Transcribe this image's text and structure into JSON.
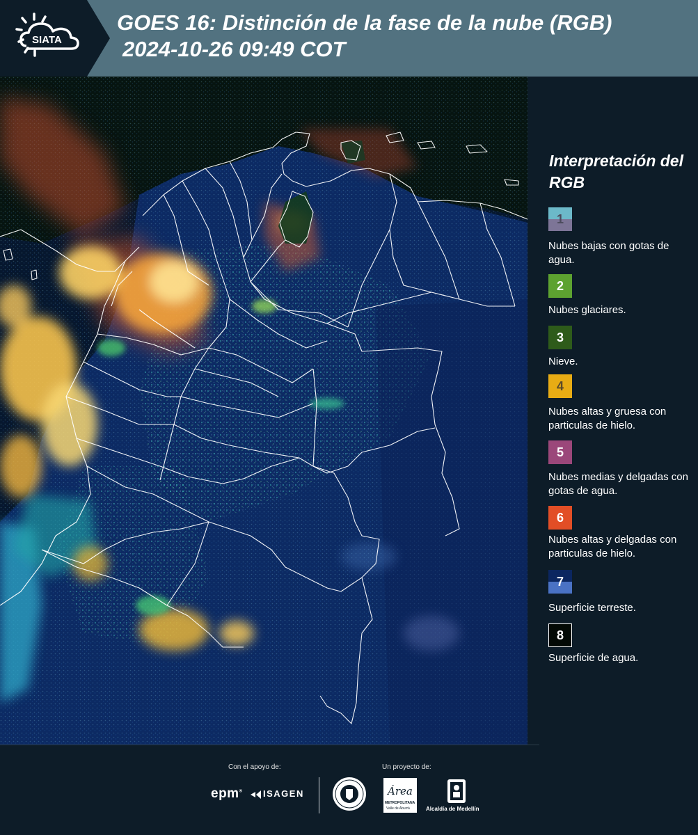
{
  "header": {
    "logo_text": "SIATA",
    "title_line1": "GOES 16: Distinción de la fase de la nube (RGB)",
    "title_line2": "2024-10-26 09:49 COT"
  },
  "legend": {
    "title": "Interpretación del RGB",
    "items": [
      {
        "number": "1",
        "label": "Nubes bajas con gotas de agua.",
        "color_top": "#6cb9c9",
        "color_bottom": "#7d7597",
        "number_color": "#4b4b5c"
      },
      {
        "number": "2",
        "label": "Nubes glaciares.",
        "color_top": "#5da230",
        "color_bottom": "#5da230",
        "number_color": "#ffffff"
      },
      {
        "number": "3",
        "label": "Nieve.",
        "color_top": "#2e5b1a",
        "color_bottom": "#2e5b1a",
        "number_color": "#ffffff"
      },
      {
        "number": "4",
        "label": "Nubes altas y gruesa con particulas de hielo.",
        "color_top": "#e8ac14",
        "color_bottom": "#e8ac14",
        "number_color": "#5a4a2a"
      },
      {
        "number": "5",
        "label": "Nubes medias y delgadas con gotas de agua.",
        "color_top": "#9b477a",
        "color_bottom": "#9b477a",
        "number_color": "#ffffff"
      },
      {
        "number": "6",
        "label": "Nubes altas y delgadas con particulas de hielo.",
        "color_top": "#e24e26",
        "color_bottom": "#e24e26",
        "number_color": "#ffffff"
      },
      {
        "number": "7",
        "label": "Superficie terreste.",
        "color_top": "#0b2660",
        "color_bottom": "#4a72c4",
        "number_color": "#ffffff"
      },
      {
        "number": "8",
        "label": "Superficie de agua.",
        "color_top": "#030905",
        "color_bottom": "#030905",
        "number_color": "#ffffff"
      }
    ]
  },
  "footer": {
    "support_label": "Con el apoyo de:",
    "project_label": "Un proyecto de:",
    "sponsors": [
      "epm",
      "ISAGEN"
    ],
    "partners": [
      "Universidad de Medellín",
      "Área Metropolitana Valle de Aburrá",
      "Alcaldía de Medellín"
    ],
    "area_logo_text": "Área",
    "area_logo_sub": "METROPOLITANA",
    "area_logo_sub2": "Valle de Aburrá",
    "alcaldia_text": "Alcaldía de Medellín"
  },
  "colors": {
    "header_bg": "#527280",
    "panel_bg": "#0d1c28",
    "map_bg": "#0b1c3e",
    "border_lines": "#ffffff"
  }
}
